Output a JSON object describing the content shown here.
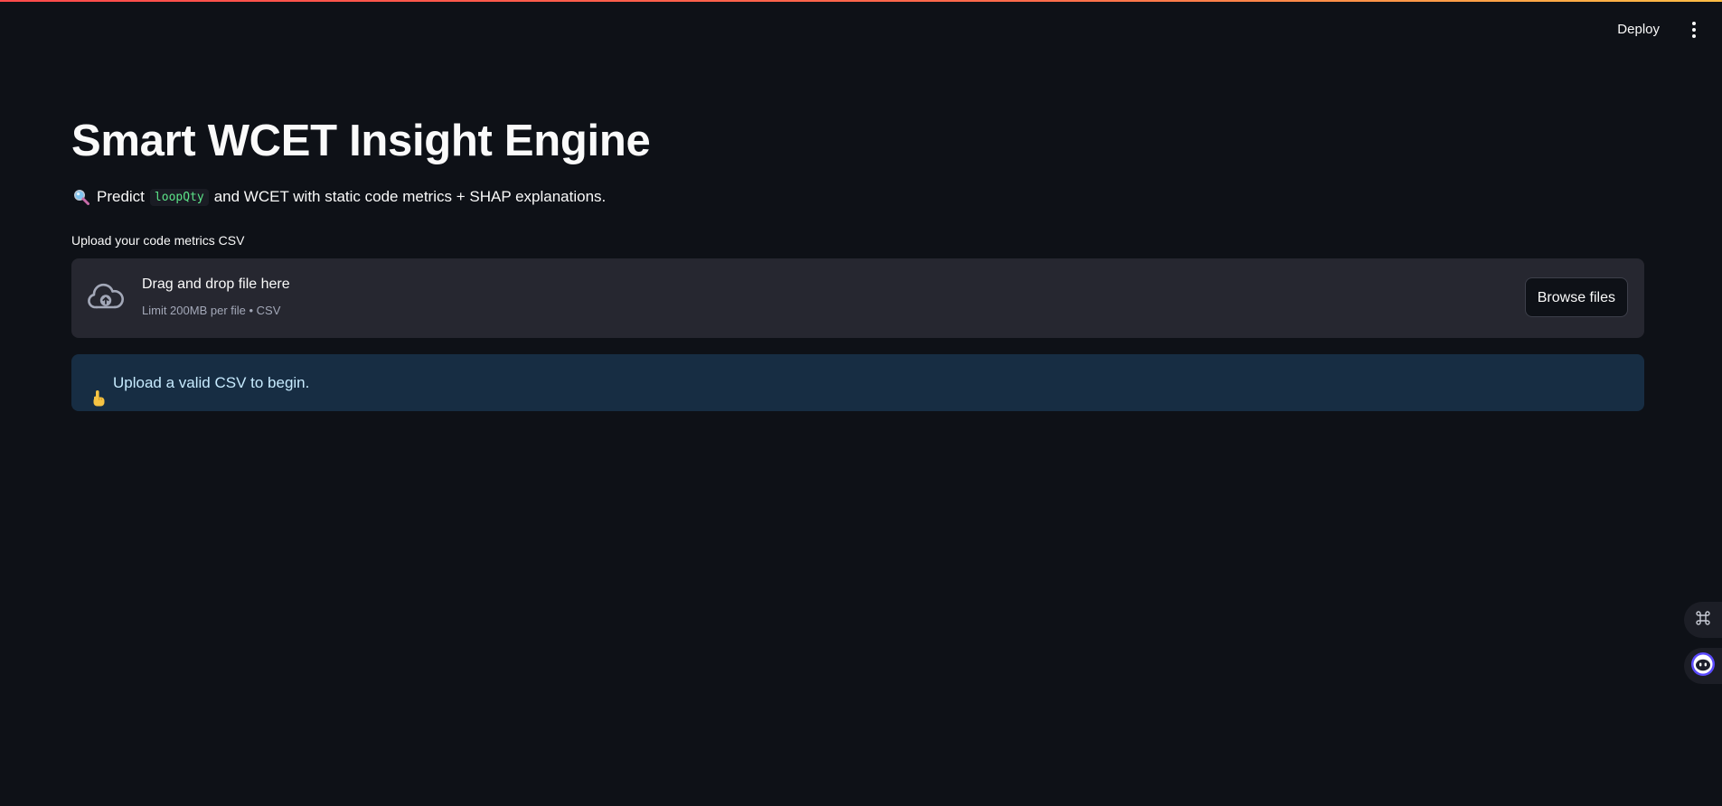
{
  "header": {
    "deploy_label": "Deploy"
  },
  "main": {
    "title": "Smart WCET Insight Engine",
    "subtitle": {
      "prefix": "Predict",
      "code": "loopQty",
      "suffix": "and WCET with static code metrics + SHAP explanations."
    },
    "uploader": {
      "label": "Upload your code metrics CSV",
      "drop_title": "Drag and drop file here",
      "drop_subtitle": "Limit 200MB per file • CSV",
      "browse_label": "Browse files"
    },
    "info": {
      "message": "Upload a valid CSV to begin."
    }
  },
  "icons": {
    "subtitle_icon": "magnifying-glass-icon",
    "upload_icon": "cloud-upload-icon",
    "info_icon": "pointing-up-hand-icon",
    "menu_icon": "vertical-dots-icon",
    "fab_1": "command-icon",
    "fab_2": "assistant-bot-icon"
  },
  "colors": {
    "background": "#0e1117",
    "dropzone": "#262730",
    "info_bg": "#172d43",
    "info_text": "#c7ebff",
    "code_text": "#5ce488",
    "accent_gradient_start": "#ff4b4b",
    "accent_gradient_end": "#ffbd45"
  }
}
